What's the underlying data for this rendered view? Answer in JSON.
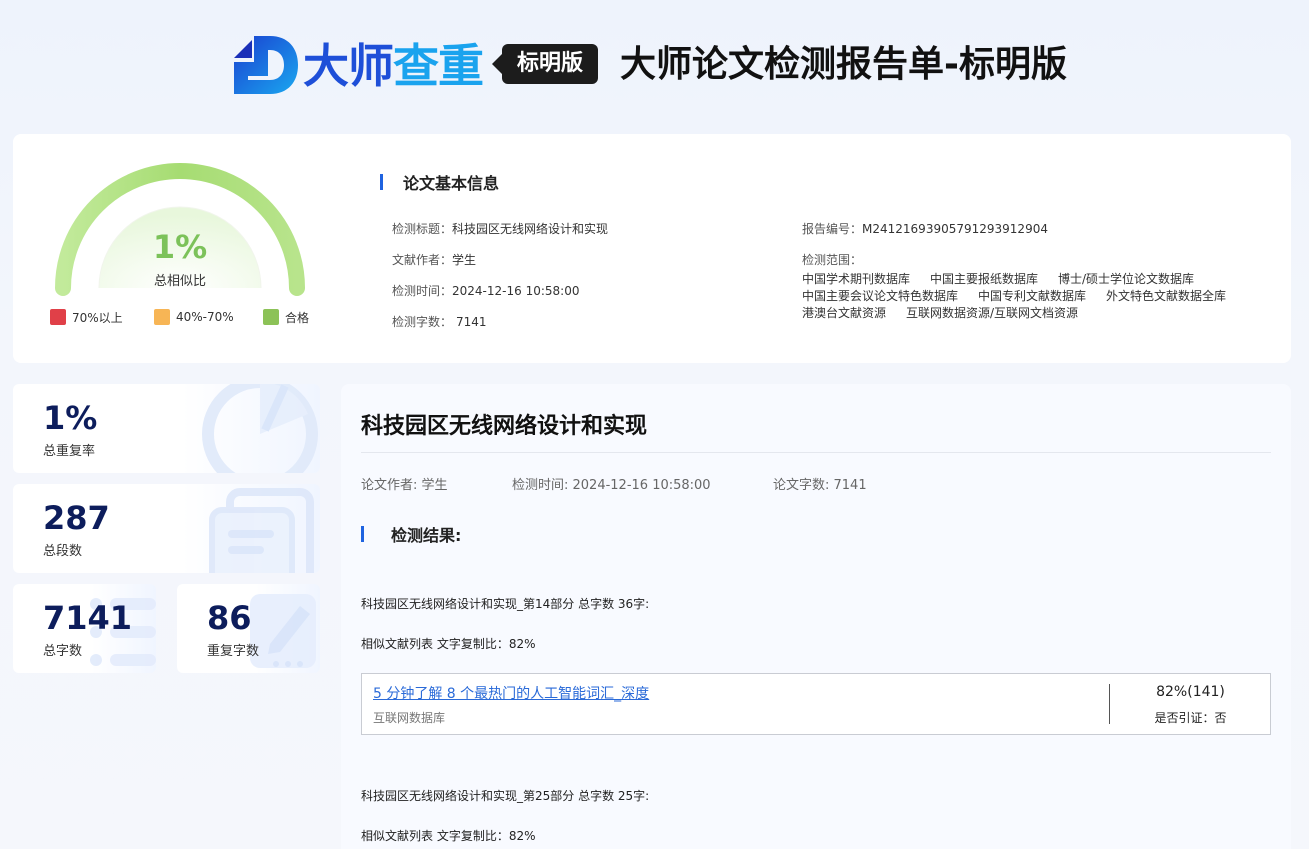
{
  "brand": {
    "name_part1": "大师",
    "name_part2": "查重",
    "edition_badge": "标明版",
    "report_title": "大师论文检测报告单-标明版",
    "logo_icon": "brand-d-logo-icon"
  },
  "summary": {
    "gauge_value": "1%",
    "gauge_fraction": 0.01,
    "gauge_label": "总相似比",
    "legend": [
      {
        "label": "70%以上",
        "color": "#e04048"
      },
      {
        "label": "40%-70%",
        "color": "#f7b555"
      },
      {
        "label": "合格",
        "color": "#8cc257"
      }
    ]
  },
  "basic_info": {
    "title": "论文基本信息",
    "check_title_key": "检测标题：",
    "check_title_value": "科技园区无线网络设计和实现",
    "author_key": "文献作者：",
    "author_value": "学生",
    "time_key": "检测时间：",
    "time_value": "2024-12-16 10:58:00",
    "words_key": "检测字数：",
    "words_value": "7141",
    "report_no_key": "报告编号：",
    "report_no_value": "M24121693905791293912904",
    "scope_key": "检测范围：",
    "scope_items": [
      "中国学术期刊数据库",
      "中国主要报纸数据库",
      "博士/硕士学位论文数据库",
      "中国主要会议论文特色数据库",
      "中国专利文献数据库",
      "外文特色文献数据全库",
      "港澳台文献资源",
      "互联网数据资源/互联网文档资源"
    ]
  },
  "stats": {
    "total_rate": {
      "value": "1%",
      "label": "总重复率"
    },
    "paragraphs": {
      "value": "287",
      "label": "总段数"
    },
    "words": {
      "value": "7141",
      "label": "总字数"
    },
    "repeat_words": {
      "value": "86",
      "label": "重复字数"
    }
  },
  "main": {
    "paper_title": "科技园区无线网络设计和实现",
    "meta_author": "论文作者: 学生",
    "meta_time": "检测时间: 2024-12-16 10:58:00",
    "meta_words": "论文字数: 7141",
    "result_title": "检测结果:",
    "parts": [
      {
        "heading": "科技园区无线网络设计和实现_第14部分 总字数 36字:",
        "similar": "相似文献列表 文字复制比：82%",
        "source_title": "5 分钟了解 8 个最热门的人工智能词汇_深度",
        "source_db": "互联网数据库",
        "source_pct": "82%(141)",
        "source_cite": "是否引证：否"
      },
      {
        "heading": "科技园区无线网络设计和实现_第25部分 总字数 25字:",
        "similar": "相似文献列表 文字复制比：82%"
      }
    ]
  }
}
